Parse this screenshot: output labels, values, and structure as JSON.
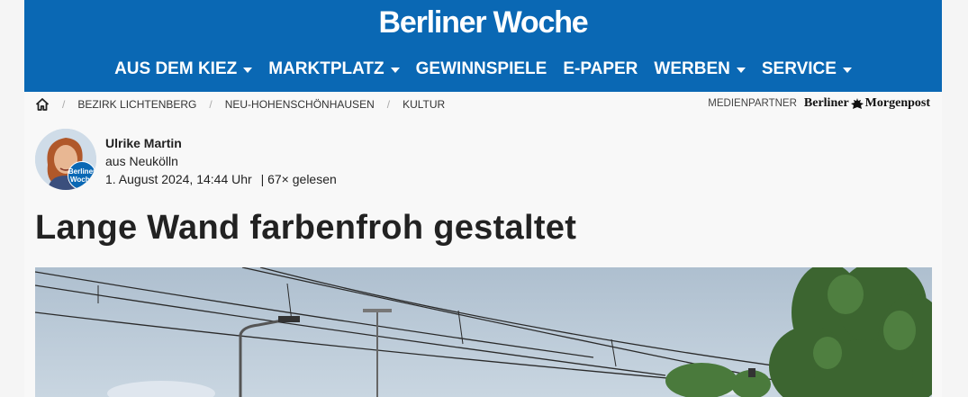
{
  "brand": {
    "name": "Berliner Woche"
  },
  "nav": [
    {
      "label": "AUS DEM KIEZ",
      "dropdown": true
    },
    {
      "label": "MARKTPLATZ",
      "dropdown": true
    },
    {
      "label": "GEWINNSPIELE",
      "dropdown": false
    },
    {
      "label": "E-PAPER",
      "dropdown": false
    },
    {
      "label": "WERBEN",
      "dropdown": true
    },
    {
      "label": "SERVICE",
      "dropdown": true
    }
  ],
  "breadcrumb": [
    "BEZIRK LICHTENBERG",
    "NEU-HOHENSCHÖNHAUSEN",
    "KULTUR"
  ],
  "partner": {
    "label": "MEDIENPARTNER",
    "name_left": "Berliner",
    "name_right": "Morgenpost"
  },
  "author": {
    "name": "Ulrike Martin",
    "location": "aus Neukölln",
    "date": "1. August 2024, 14:44 Uhr",
    "reads": "| 67× gelesen",
    "badge_line1": "Berliner",
    "badge_line2": "Woche"
  },
  "article": {
    "title": "Lange Wand farbenfroh gestaltet"
  },
  "colors": {
    "brand_blue": "#0a68b4",
    "sky": "#b8c9d8",
    "tree": "#3f6a33"
  },
  "icons": {
    "home": "home-icon",
    "caret": "chevron-down-icon"
  }
}
